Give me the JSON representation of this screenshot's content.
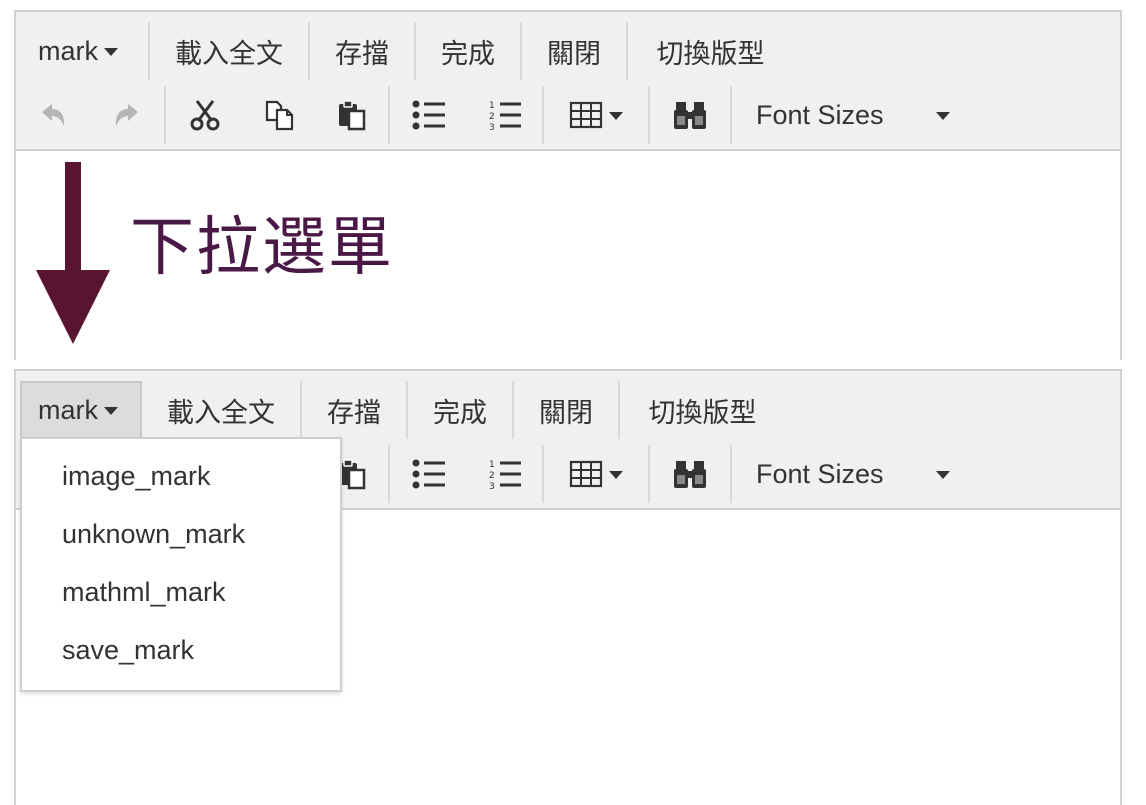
{
  "annotation": {
    "text": "下拉選單"
  },
  "menubar": {
    "mark_label": "mark",
    "load_label": "載入全文",
    "save_label": "存擋",
    "done_label": "完成",
    "close_label": "關閉",
    "switch_label": "切換版型"
  },
  "toolbar": {
    "font_sizes_label": "Font Sizes",
    "icons": [
      "undo-icon",
      "redo-icon",
      "cut-icon",
      "copy-icon",
      "paste-icon",
      "bullet-list-icon",
      "numbered-list-icon",
      "table-icon",
      "find-icon"
    ]
  },
  "dropdown": {
    "items": [
      {
        "label": "image_mark"
      },
      {
        "label": "unknown_mark"
      },
      {
        "label": "mathml_mark"
      },
      {
        "label": "save_mark"
      }
    ]
  },
  "colors": {
    "annotation": "#4a1846",
    "arrow": "#5a1530",
    "toolbar_bg": "#f0f0f0"
  }
}
